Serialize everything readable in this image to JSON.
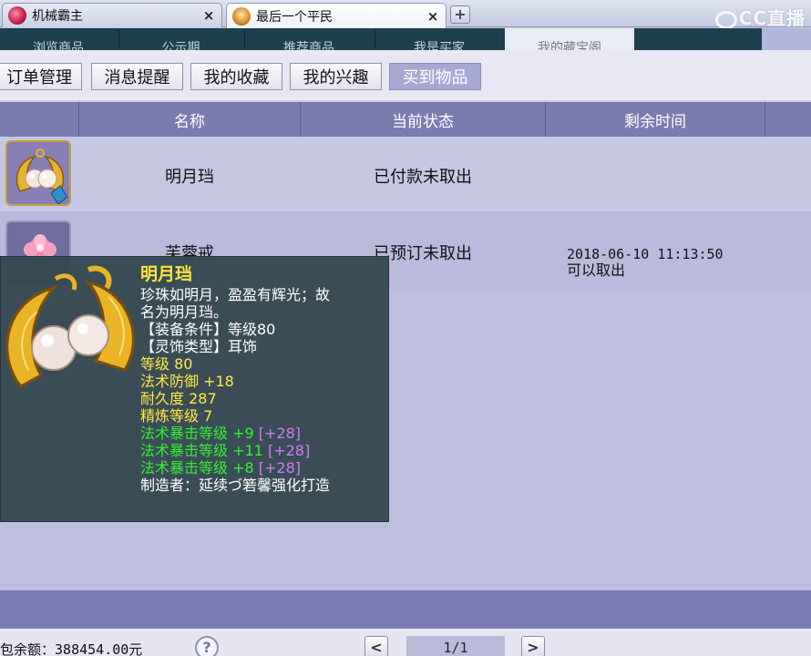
{
  "browser": {
    "tabs": [
      {
        "label": "机械霸主",
        "close": "×"
      },
      {
        "label": "最后一个平民",
        "close": "×"
      }
    ],
    "new_tab": "+",
    "logo_text": "CC直播"
  },
  "topnav": {
    "tabs": [
      "浏览商品",
      "公示期",
      "推荐商品",
      "我是买家",
      "我的藏宝阁"
    ]
  },
  "subtabs": {
    "items": [
      "订单管理",
      "消息提醒",
      "我的收藏",
      "我的兴趣",
      "买到物品"
    ],
    "active_index": 4
  },
  "table": {
    "headers": [
      "名称",
      "当前状态",
      "剩余时间"
    ],
    "rows": [
      {
        "name": "明月珰",
        "status": "已付款未取出",
        "time": "",
        "time_note": ""
      },
      {
        "name": "芙蓉戒",
        "status": "已预订未取出",
        "time": "2018-06-10 11:13:50",
        "time_note": "可以取出"
      }
    ]
  },
  "tooltip": {
    "title": "明月珰",
    "desc_line1": "珍珠如明月，盈盈有辉光；故",
    "desc_line2": "名为明月珰。",
    "equip_req": "【装备条件】等级80",
    "accessory_type": "【灵饰类型】耳饰",
    "stats_yellow": [
      "等级 80",
      "法术防御 +18",
      "耐久度 287",
      "精炼等级 7"
    ],
    "stats_green": [
      {
        "label": "法术暴击等级 +9",
        "bonus": "[+28]"
      },
      {
        "label": "法术暴击等级 +11",
        "bonus": "[+28]"
      },
      {
        "label": "法术暴击等级 +8",
        "bonus": "[+28]"
      }
    ],
    "maker": "制造者：延续づ箬馨强化打造"
  },
  "footer": {
    "balance_label": "包余额：",
    "balance_value": "388454.00元",
    "help": "?",
    "prev": "<",
    "page": "1/1",
    "next": ">"
  },
  "colors": {
    "topnav_bg": "#1d3f4e",
    "header_bg": "#7a7cae",
    "active_subtab": "#a7a9d3",
    "tooltip_bg": "#344850",
    "tooltip_title": "#ffe33a",
    "tooltip_green": "#37ee30",
    "tooltip_purple": "#d27bf0"
  }
}
